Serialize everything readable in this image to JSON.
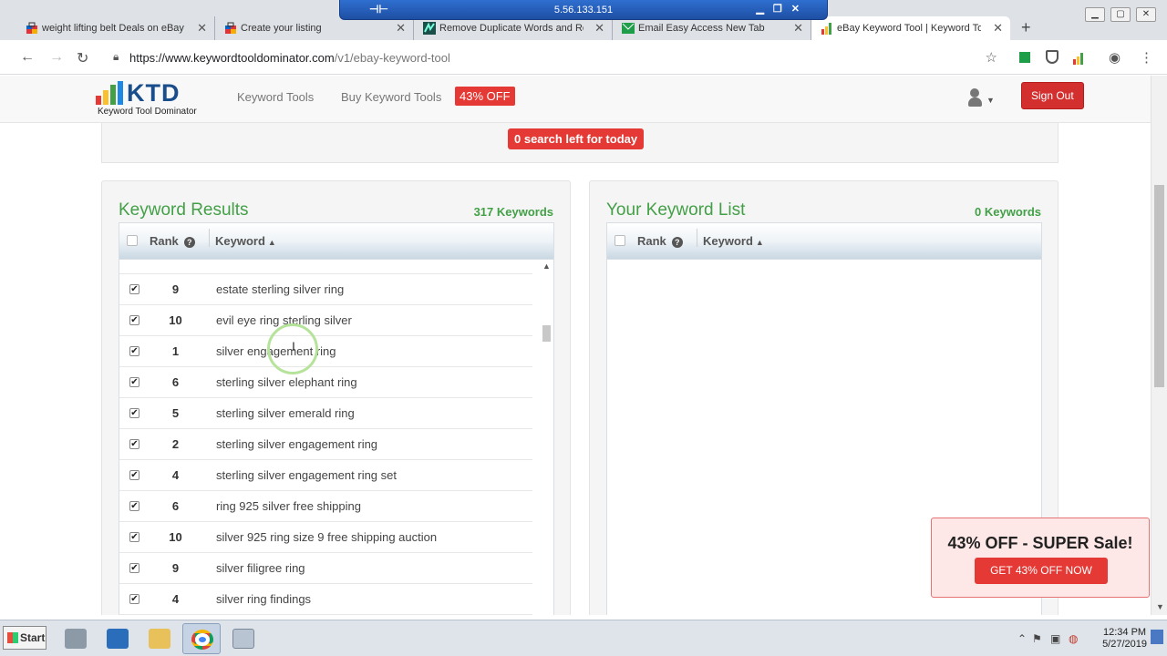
{
  "remote": {
    "ip": "5.56.133.151"
  },
  "tabs": [
    {
      "title": "weight lifting belt Deals on eBay",
      "icon": "ebay-bag-icon"
    },
    {
      "title": "Create your listing",
      "icon": "ebay-bag-icon"
    },
    {
      "title": "Remove Duplicate Words and Repe",
      "icon": "site-icon"
    },
    {
      "title": "Email Easy Access New Tab",
      "icon": "email-icon"
    },
    {
      "title": "eBay Keyword Tool | Keyword Tool",
      "icon": "ktd-icon"
    }
  ],
  "address": {
    "domain": "https://www.keywordtooldominator.com",
    "path": "/v1/ebay-keyword-tool"
  },
  "nav": {
    "logo_text": "KTD",
    "logo_sub": "Keyword Tool Dominator",
    "keyword_tools": "Keyword Tools",
    "buy_keyword_tools": "Buy Keyword Tools",
    "discount_badge": "43% OFF",
    "sign_out": "Sign Out"
  },
  "search_status": "0 search left for today",
  "results_panel": {
    "title": "Keyword Results",
    "count": "317 Keywords",
    "col_rank": "Rank",
    "col_keyword": "Keyword",
    "help_glyph": "?",
    "rows": [
      {
        "rank": "9",
        "keyword": "estate sterling silver ring"
      },
      {
        "rank": "10",
        "keyword": "evil eye ring sterling silver"
      },
      {
        "rank": "1",
        "keyword": "silver engagement ring"
      },
      {
        "rank": "6",
        "keyword": "sterling silver elephant ring"
      },
      {
        "rank": "5",
        "keyword": "sterling silver emerald ring"
      },
      {
        "rank": "2",
        "keyword": "sterling silver engagement ring"
      },
      {
        "rank": "4",
        "keyword": "sterling silver engagement ring set"
      },
      {
        "rank": "6",
        "keyword": "ring 925 silver free shipping"
      },
      {
        "rank": "10",
        "keyword": "silver 925 ring size 9 free shipping auction"
      },
      {
        "rank": "9",
        "keyword": "silver filigree ring"
      },
      {
        "rank": "4",
        "keyword": "silver ring findings"
      }
    ]
  },
  "list_panel": {
    "title": "Your Keyword List",
    "count": "0 Keywords",
    "col_rank": "Rank",
    "col_keyword": "Keyword",
    "help_glyph": "?"
  },
  "sale": {
    "title": "43% OFF - SUPER Sale!",
    "button": "GET 43% OFF NOW"
  },
  "taskbar": {
    "start": "Start",
    "time": "12:34 PM",
    "date": "5/27/2019"
  },
  "colors": {
    "accent_green": "#43a047",
    "brand_red": "#e53935",
    "brand_blue": "#1a4d8c"
  }
}
